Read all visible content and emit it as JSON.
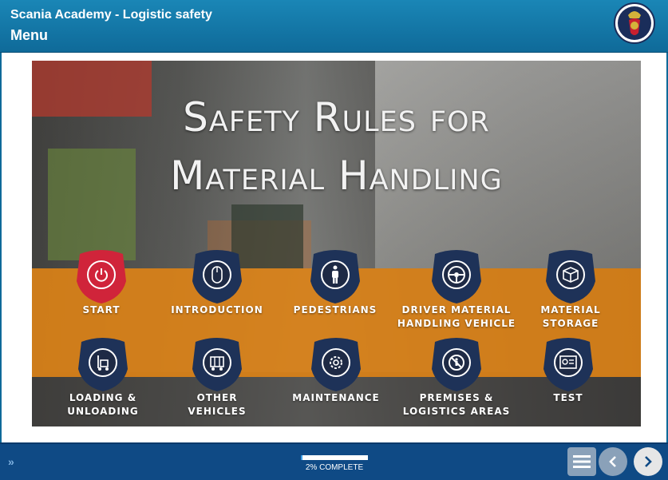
{
  "header": {
    "course_title": "Scania Academy - Logistic safety",
    "page_title": "Menu",
    "logo_icon": "scania-griffin-logo"
  },
  "stage": {
    "headline_line1": "Safety Rules for",
    "headline_line2": "Material Handling"
  },
  "menu": {
    "items": [
      {
        "label": "START",
        "icon": "power-icon",
        "color": "#d0243a"
      },
      {
        "label": "INTRODUCTION",
        "icon": "mouse-icon",
        "color": "#1e3258"
      },
      {
        "label": "PEDESTRIANS",
        "icon": "pedestrian-icon",
        "color": "#1e3258"
      },
      {
        "label": "DRIVER MATERIAL\nHANDLING VEHICLE",
        "icon": "steering-wheel-icon",
        "color": "#1e3258"
      },
      {
        "label": "MATERIAL\nSTORAGE",
        "icon": "box-icon",
        "color": "#1e3258"
      },
      {
        "label": "LOADING &\nUNLOADING",
        "icon": "hand-truck-icon",
        "color": "#1e3258"
      },
      {
        "label": "OTHER\nVEHICLES",
        "icon": "cart-icon",
        "color": "#1e3258"
      },
      {
        "label": "MAINTENANCE",
        "icon": "gear-icon",
        "color": "#1e3258"
      },
      {
        "label": "PREMISES &\nLOGISTICS AREAS",
        "icon": "no-entry-icon",
        "color": "#1e3258"
      },
      {
        "label": "TEST",
        "icon": "certificate-icon",
        "color": "#1e3258"
      }
    ]
  },
  "footer": {
    "progress_percent": 2,
    "progress_text": "2% COMPLETE"
  },
  "colors": {
    "header": "#0f6a99",
    "footer": "#0f4a85",
    "orange_band": "#de8316",
    "badge_navy": "#1e3258",
    "badge_red": "#d0243a"
  }
}
